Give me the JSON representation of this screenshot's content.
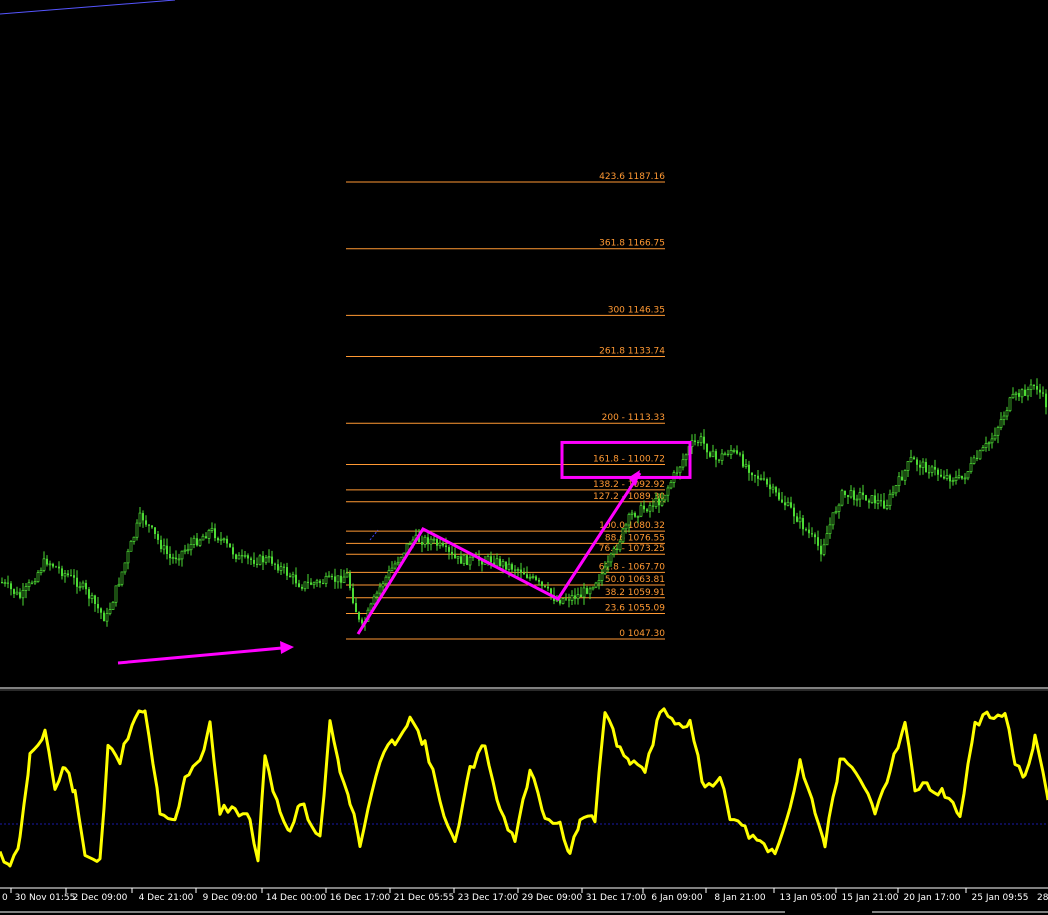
{
  "chart_data": [
    {
      "type": "candlestick",
      "series": [
        {
          "name": "",
          "color": "#4ddb35"
        }
      ],
      "fibonacci": {
        "color": "#ff9933",
        "levels": [
          {
            "label": "423.6 1187.16",
            "price": 1187.16
          },
          {
            "label": "361.8 1166.75",
            "price": 1166.75
          },
          {
            "label": "300 1146.35",
            "price": 1146.35
          },
          {
            "label": "261.8 1133.74",
            "price": 1133.74
          },
          {
            "label": "200 - 1113.33",
            "price": 1113.33
          },
          {
            "label": "161.8 -  1100.72",
            "price": 1100.72
          },
          {
            "label": "138.2 - 1092.92",
            "price": 1092.92
          },
          {
            "label": "127.2 - 1089.30",
            "price": 1089.3
          },
          {
            "label": "100.0 1080.32",
            "price": 1080.32
          },
          {
            "label": "88.6 1076.55",
            "price": 1076.55
          },
          {
            "label": "76.4 - 1073.25",
            "price": 1073.25
          },
          {
            "label": "61.8 - 1067.70",
            "price": 1067.7
          },
          {
            "label": "50.0 1063.81",
            "price": 1063.81
          },
          {
            "label": "38.2 1059.91",
            "price": 1059.91
          },
          {
            "label": "23.6 1055.09",
            "price": 1055.09
          },
          {
            "label": "0 1047.30",
            "price": 1047.3
          }
        ]
      },
      "annotations": {
        "color": "#ff00ff",
        "zigzag": [
          {
            "time": "17 Dec",
            "price": 1047.3
          },
          {
            "time": "21 Dec",
            "price": 1080.32
          },
          {
            "time": "29 Dec",
            "price": 1059.91
          },
          {
            "time": "3 Jan",
            "price": 1100.72
          }
        ],
        "highlight_box": {
          "level": "161.8",
          "price": 1100.72
        },
        "arrow": "lower-left pointing right"
      }
    },
    {
      "type": "line",
      "series": [
        {
          "name": "",
          "color": "#ffff00"
        }
      ],
      "reference_line": {
        "style": "dotted",
        "color": "#0000cc"
      }
    }
  ],
  "time_axis": {
    "labels": [
      "30 Nov 01:55",
      "2 Dec 09:00",
      "4 Dec 21:00",
      "9 Dec 09:00",
      "14 Dec 00:00",
      "16 Dec 17:00",
      "21 Dec 05:55",
      "23 Dec 17:00",
      "29 Dec 09:00",
      "31 Dec 17:00",
      "6 Jan 09:00",
      "8 Jan 21:00",
      "13 Jan 05:00",
      "15 Jan 21:00",
      "20 Jan 17:00",
      "25 Jan 09:55"
    ],
    "partial_left": "0",
    "partial_right": "28"
  }
}
